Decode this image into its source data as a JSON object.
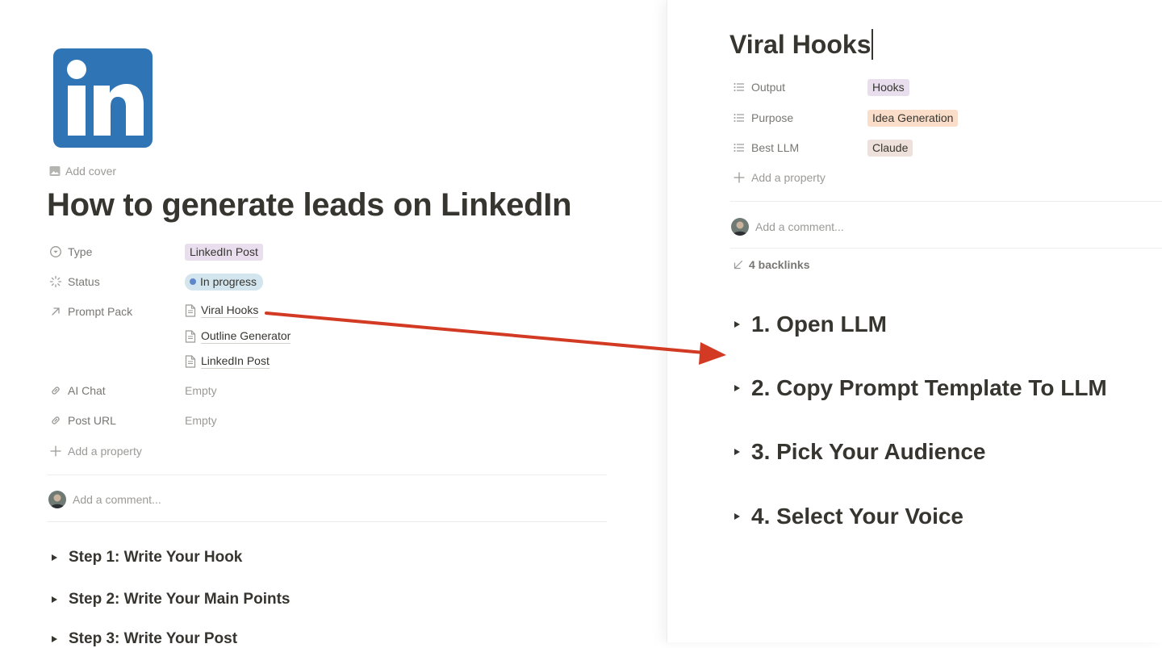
{
  "left_page": {
    "add_cover": "Add cover",
    "title": "How to generate leads on LinkedIn",
    "properties": {
      "type": {
        "label": "Type",
        "value": "LinkedIn Post",
        "icon": "select-icon"
      },
      "status": {
        "label": "Status",
        "value": "In progress",
        "icon": "status-icon"
      },
      "prompt_pack": {
        "label": "Prompt Pack",
        "icon": "relation-arrow-icon",
        "items": [
          "Viral Hooks",
          "Outline Generator",
          "LinkedIn Post"
        ]
      },
      "ai_chat": {
        "label": "AI Chat",
        "value": "Empty",
        "icon": "link-icon"
      },
      "post_url": {
        "label": "Post URL",
        "value": "Empty",
        "icon": "link-icon"
      },
      "add_property": "Add a property"
    },
    "comment_placeholder": "Add a comment...",
    "toggles": [
      "Step 1: Write Your Hook",
      "Step 2: Write Your Main Points",
      "Step 3: Write Your Post"
    ]
  },
  "right_page": {
    "title": "Viral Hooks",
    "properties": {
      "output": {
        "label": "Output",
        "value": "Hooks"
      },
      "purpose": {
        "label": "Purpose",
        "value": "Idea Generation"
      },
      "best_llm": {
        "label": "Best LLM",
        "value": "Claude"
      },
      "add_property": "Add a property"
    },
    "comment_placeholder": "Add a comment...",
    "backlinks": "4 backlinks",
    "toggles": [
      "1. Open LLM",
      "2. Copy Prompt Template To LLM",
      "3. Pick Your Audience",
      "4. Select Your Voice"
    ]
  },
  "colors": {
    "linkedin_blue": "#2f74b5",
    "annotation_arrow": "#d33a24",
    "tag_purple": "#e8deee",
    "tag_orange": "#fadec9",
    "tag_brown": "#eee0da",
    "status_blue": "#d3e5ef"
  }
}
